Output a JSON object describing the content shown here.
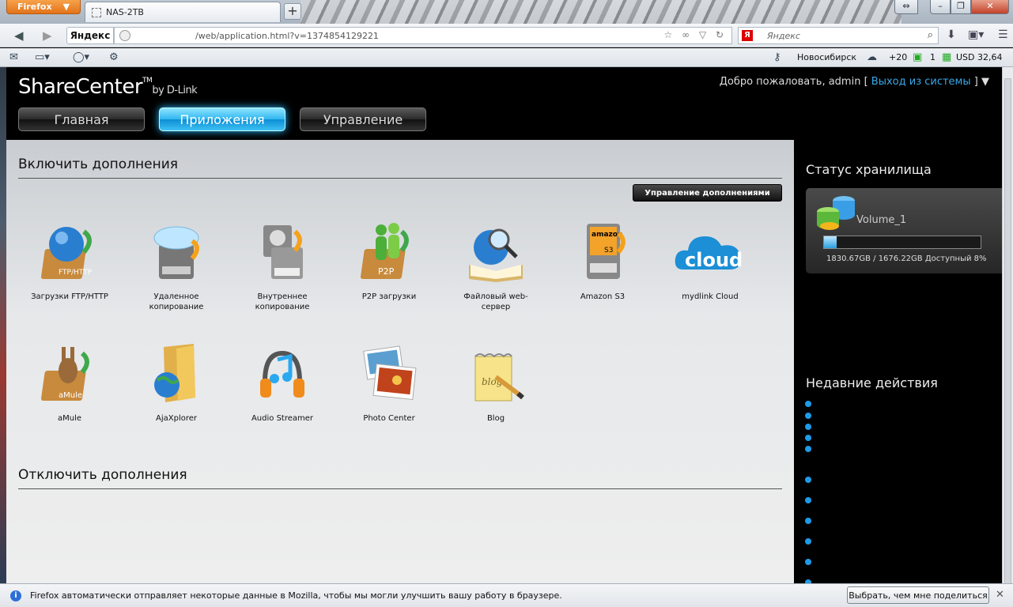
{
  "browser": {
    "menu_button": "Firefox",
    "tab_title": "NAS-2TB",
    "new_tab": "+",
    "url": "/web/application.html?v=1374854129221",
    "yandex_label": "Яндекс",
    "search_placeholder": "Яндекс",
    "city": "Новосибирск",
    "weather": "+20",
    "mail_count": "1",
    "currency": "USD 32,64"
  },
  "header": {
    "logo": "ShareCenter",
    "logo_tm": "TM",
    "logo_by": "by D-Link",
    "welcome": "Добро пожаловать, admin [",
    "logout": "Выход из системы",
    "welcome_end": "]",
    "nav": [
      {
        "label": "Главная",
        "active": false
      },
      {
        "label": "Приложения",
        "active": true
      },
      {
        "label": "Управление",
        "active": false
      }
    ]
  },
  "main": {
    "enabled_title": "Включить дополнения",
    "manage_button": "Управление дополнениями",
    "disabled_title": "Отключить дополнения",
    "apps_row1": [
      {
        "label": "Загрузки FTP/HTTP",
        "icon": "ftp-http-icon"
      },
      {
        "label": "Удаленное копирование",
        "icon": "remote-backup-icon"
      },
      {
        "label": "Внутреннее копирование",
        "icon": "local-backup-icon"
      },
      {
        "label": "P2P загрузки",
        "icon": "p2p-icon"
      },
      {
        "label": "Файловый web-сервер",
        "icon": "web-file-server-icon"
      },
      {
        "label": "Amazon S3",
        "icon": "amazon-s3-icon"
      },
      {
        "label": "mydlink Cloud",
        "icon": "mydlink-cloud-icon"
      }
    ],
    "apps_row2": [
      {
        "label": "aMule",
        "icon": "amule-icon"
      },
      {
        "label": "AjaXplorer",
        "icon": "ajaxplorer-icon"
      },
      {
        "label": "Audio Streamer",
        "icon": "audio-streamer-icon"
      },
      {
        "label": "Photo Center",
        "icon": "photo-center-icon"
      },
      {
        "label": "Blog",
        "icon": "blog-icon"
      }
    ]
  },
  "sidebar": {
    "storage_title": "Статус хранилища",
    "volume_name": "Volume_1",
    "volume_info": "1830.67GB / 1676.22GB Доступный   8%",
    "usage_percent": 8,
    "recent_title": "Недавние действия",
    "recent_items": 11
  },
  "notification": {
    "text": "Firefox автоматически отправляет некоторые данные в Mozilla, чтобы мы могли улучшить вашу работу в браузере.",
    "button": "Выбрать, чем мне поделиться",
    "close": "✕"
  },
  "colors": {
    "accent": "#2fb6f0",
    "link": "#3aa8e8",
    "dot": "#1e9be8"
  }
}
